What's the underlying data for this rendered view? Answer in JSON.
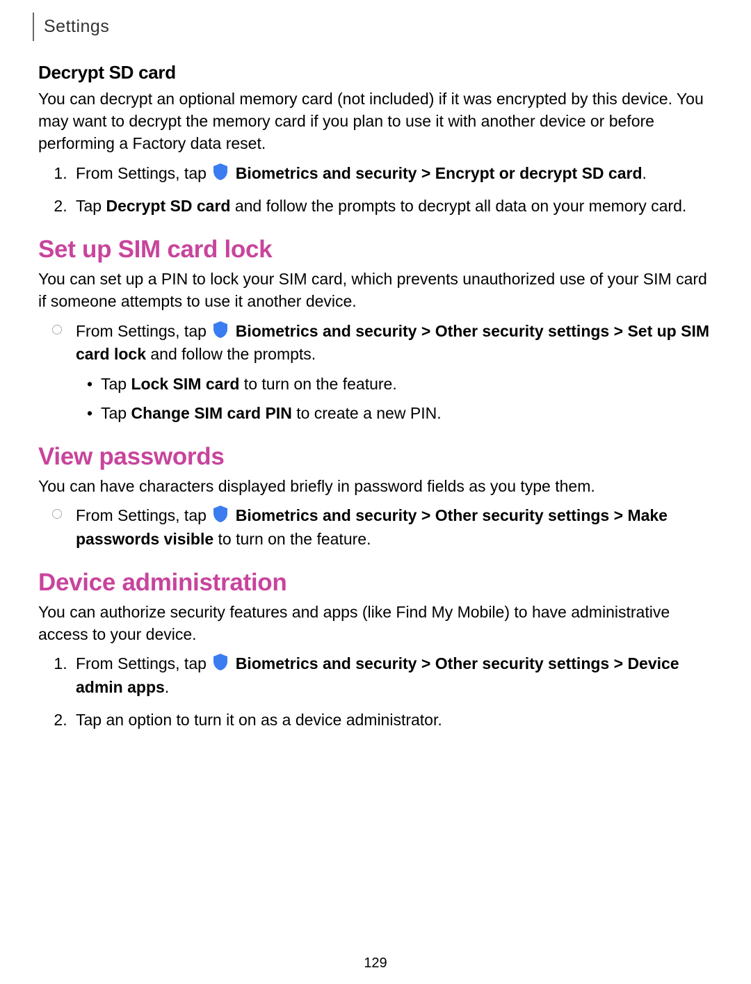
{
  "header": "Settings",
  "decrypt": {
    "title": "Decrypt SD card",
    "desc": "You can decrypt an optional memory card (not included) if it was encrypted by this device. You may want to decrypt the memory card if you plan to use it with another device or before performing a Factory data reset.",
    "step1_pre": "From Settings, tap ",
    "step1_b1": "Biometrics and security",
    "step1_gt": " > ",
    "step1_b2": "Encrypt or decrypt SD card",
    "step1_dot": ".",
    "step2_pre": "Tap ",
    "step2_b": "Decrypt SD card",
    "step2_post": " and follow the prompts to decrypt all data on your memory card."
  },
  "sim": {
    "title": "Set up SIM card lock",
    "desc": "You can set up a PIN to lock your SIM card, which prevents unauthorized use of your SIM card if someone attempts to use it another device.",
    "bullet_pre": "From Settings, tap ",
    "bullet_b1": "Biometrics and security",
    "bullet_gt1": " > ",
    "bullet_b2": "Other security settings",
    "bullet_gt2": " > ",
    "bullet_b3": "Set up SIM card lock",
    "bullet_post": " and follow the prompts.",
    "inner1_pre": "Tap ",
    "inner1_b": "Lock SIM card",
    "inner1_post": " to turn on the feature.",
    "inner2_pre": "Tap ",
    "inner2_b": "Change SIM card PIN",
    "inner2_post": " to create a new PIN."
  },
  "viewpw": {
    "title": "View passwords",
    "desc": "You can have characters displayed briefly in password fields as you type them.",
    "bullet_pre": "From Settings, tap ",
    "bullet_b1": "Biometrics and security",
    "bullet_gt1": " > ",
    "bullet_b2": "Other security settings",
    "bullet_gt2": " > ",
    "bullet_b3": "Make passwords visible",
    "bullet_post": " to turn on the feature."
  },
  "devadmin": {
    "title": "Device administration",
    "desc": "You can authorize security features and apps (like Find My Mobile) to have administrative access to your device.",
    "step1_pre": "From Settings, tap ",
    "step1_b1": "Biometrics and security",
    "step1_gt1": " > ",
    "step1_b2": "Other security settings",
    "step1_gt2": " > ",
    "step1_b3": "Device admin apps",
    "step1_dot": ".",
    "step2": "Tap an option to turn it on as a device administrator."
  },
  "page_number": "129"
}
